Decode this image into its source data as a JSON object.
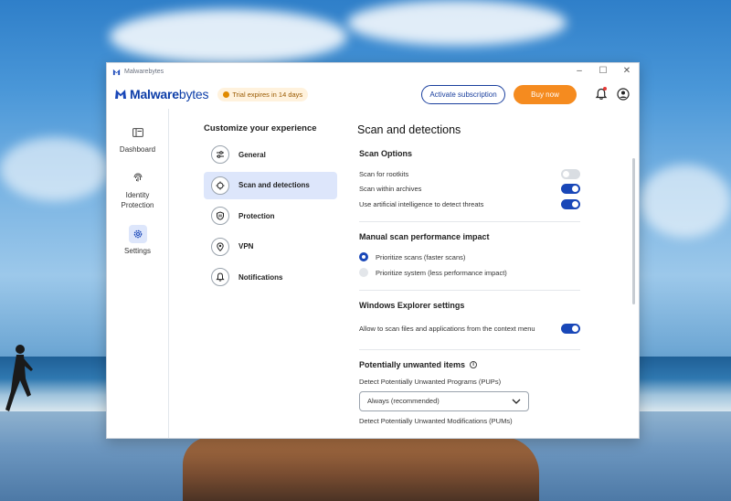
{
  "window": {
    "app_name": "Malwarebytes",
    "controls": {
      "minimize": "–",
      "maximize": "☐",
      "close": "✕"
    }
  },
  "header": {
    "logo_bold": "Malware",
    "logo_light": "bytes",
    "trial_badge": "Trial expires in 14 days",
    "activate_label": "Activate subscription",
    "buy_label": "Buy now",
    "notification_icon": "bell-icon",
    "account_icon": "user-circle-icon"
  },
  "nav": {
    "items": [
      {
        "label": "Dashboard",
        "icon": "dashboard-icon",
        "active": false
      },
      {
        "label": "Identity Protection",
        "icon": "fingerprint-icon",
        "active": false
      },
      {
        "label": "Settings",
        "icon": "gear-icon",
        "active": true
      }
    ]
  },
  "menu": {
    "title": "Customize your experience",
    "items": [
      {
        "label": "General",
        "icon": "sliders-icon",
        "active": false
      },
      {
        "label": "Scan and detections",
        "icon": "crosshair-icon",
        "active": true
      },
      {
        "label": "Protection",
        "icon": "shield-icon",
        "active": false
      },
      {
        "label": "VPN",
        "icon": "location-pin-icon",
        "active": false
      },
      {
        "label": "Notifications",
        "icon": "bell-icon",
        "active": false
      }
    ]
  },
  "content": {
    "title": "Scan and detections",
    "scan_options": {
      "title": "Scan Options",
      "rows": [
        {
          "label": "Scan for rootkits",
          "on": false
        },
        {
          "label": "Scan within archives",
          "on": true
        },
        {
          "label": "Use artificial intelligence to detect threats",
          "on": true
        }
      ]
    },
    "performance": {
      "title": "Manual scan performance impact",
      "options": [
        {
          "label": "Prioritize scans (faster scans)",
          "checked": true
        },
        {
          "label": "Prioritize system (less performance impact)",
          "checked": false
        }
      ]
    },
    "explorer": {
      "title": "Windows Explorer settings",
      "row_label": "Allow to scan files and applications from the context menu",
      "on": true
    },
    "pup": {
      "title": "Potentially unwanted items",
      "info_icon": "i",
      "pup_label": "Detect Potentially Unwanted Programs (PUPs)",
      "pup_value": "Always (recommended)",
      "pum_label": "Detect Potentially Unwanted Modifications (PUMs)"
    }
  },
  "colors": {
    "brand_blue": "#1947b8",
    "buy_orange": "#f58b1f",
    "active_bg": "#dde6fb"
  }
}
